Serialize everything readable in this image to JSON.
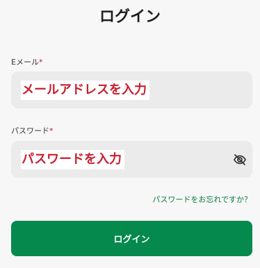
{
  "title": "ログイン",
  "email": {
    "label": "Eメール",
    "required_mark": "*",
    "placeholder": "メールアドレスを入力"
  },
  "password": {
    "label": "パスワード",
    "required_mark": "*",
    "placeholder": "パスワードを入力",
    "visibility_icon": "eye-off-icon"
  },
  "forgot_link": "パスワードをお忘れですか？",
  "login_button": "ログイン",
  "colors": {
    "background": "#f7f7f7",
    "input_bg": "#ebebeb",
    "required": "#c0182b",
    "link": "#0a7a3e",
    "primary_button": "#05894d",
    "placeholder_text": "#c81e2e"
  }
}
